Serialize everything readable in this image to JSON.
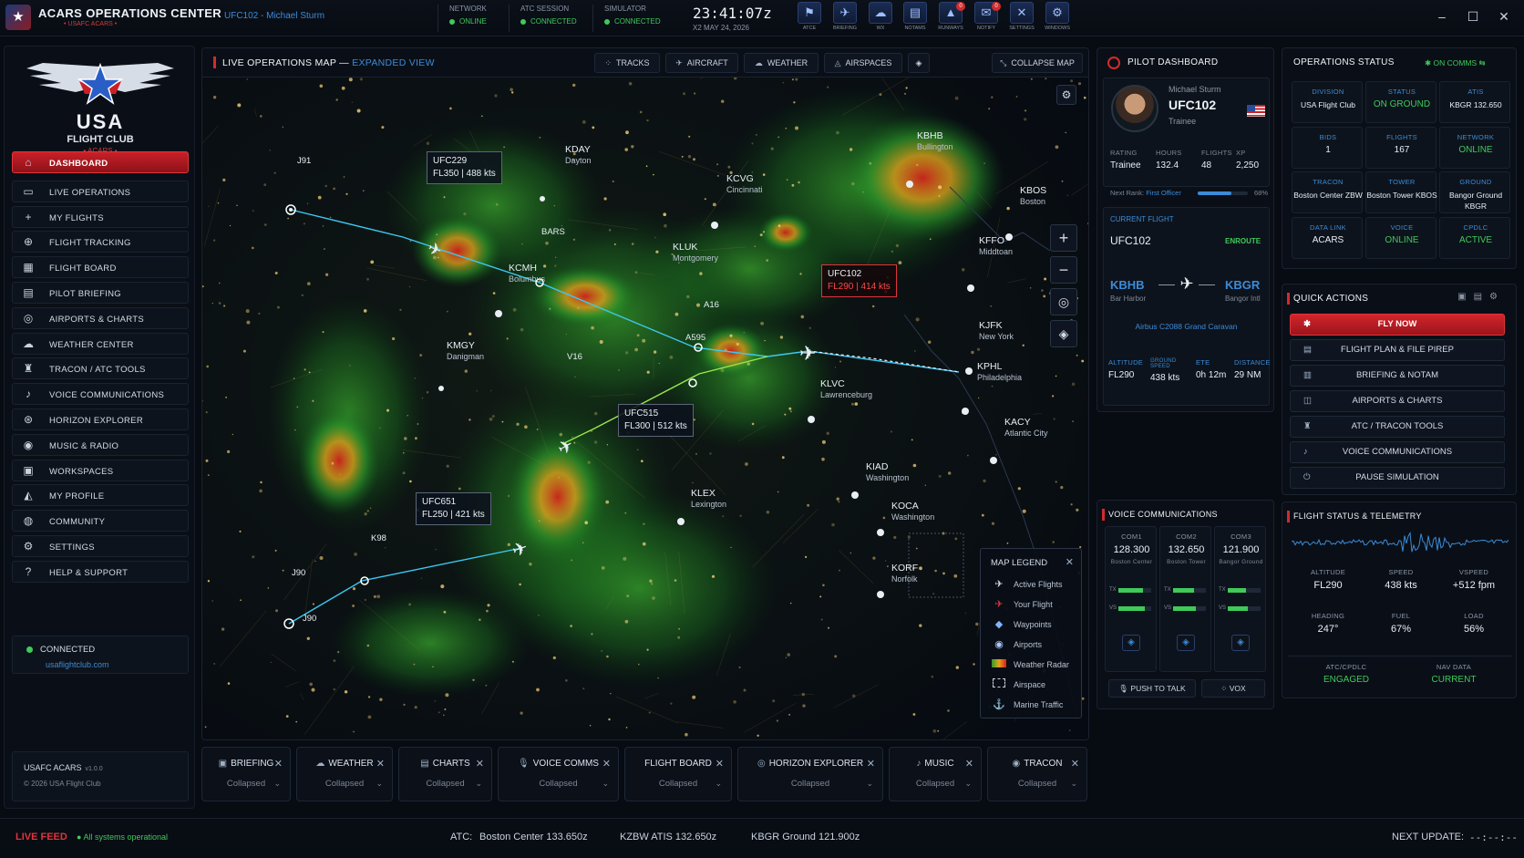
{
  "topbar": {
    "title": "ACARS OPERATIONS CENTER",
    "subtitle": "• USAFC ACARS •",
    "flight_user": "UFC102 - Michael Sturm",
    "network_label": "NETWORK",
    "network_value": "ONLINE",
    "atc_label": "ATC SESSION",
    "atc_value": "CONNECTED",
    "sim_label": "SIMULATOR",
    "sim_value": "CONNECTED",
    "time": "23:41:07z",
    "date": "X2 MAY 24, 2026",
    "buttons": [
      {
        "label": "ATCE",
        "icon": "atc-icon"
      },
      {
        "label": "BRIEFING",
        "icon": "briefing-icon"
      },
      {
        "label": "WX",
        "icon": "weather-icon"
      },
      {
        "label": "NOTAMS",
        "icon": "notams-icon"
      },
      {
        "label": "RUNWAYS",
        "icon": "runways-icon",
        "badge": "0"
      },
      {
        "label": "NOTIFY",
        "icon": "notify-icon",
        "badge": "0"
      },
      {
        "label": "SETTINGS",
        "icon": "settings-icon"
      },
      {
        "label": "WINDOWS",
        "icon": "windows-icon"
      }
    ]
  },
  "sidebar": {
    "brand_title": "USA",
    "brand_sub": "FLIGHT CLUB",
    "brand_tag": "• ACARS •",
    "items": [
      {
        "label": "DASHBOARD",
        "icon": "home-icon",
        "active": true
      },
      {
        "label": "LIVE OPERATIONS",
        "icon": "monitor-icon"
      },
      {
        "label": "MY FLIGHTS",
        "icon": "plane-icon"
      },
      {
        "label": "FLIGHT TRACKING",
        "icon": "target-icon"
      },
      {
        "label": "FLIGHT BOARD",
        "icon": "board-icon"
      },
      {
        "label": "PILOT BRIEFING",
        "icon": "clipboard-icon"
      },
      {
        "label": "AIRPORTS & CHARTS",
        "icon": "airport-icon"
      },
      {
        "label": "WEATHER CENTER",
        "icon": "cloud-icon"
      },
      {
        "label": "TRACON / ATC TOOLS",
        "icon": "tower-icon"
      },
      {
        "label": "VOICE COMMUNICATIONS",
        "icon": "microphone-icon"
      },
      {
        "label": "HORIZON EXPLORER",
        "icon": "compass-icon"
      },
      {
        "label": "MUSIC & RADIO",
        "icon": "music-icon"
      },
      {
        "label": "WORKSPACES",
        "icon": "workspace-icon"
      },
      {
        "label": "MY PROFILE",
        "icon": "profile-icon"
      },
      {
        "label": "COMMUNITY",
        "icon": "community-icon"
      },
      {
        "label": "SETTINGS",
        "icon": "gear-icon"
      },
      {
        "label": "HELP & SUPPORT",
        "icon": "help-icon"
      }
    ],
    "connection_label": "CONNECTED",
    "connection_url": "usaflightclub.com",
    "footer_app": "USAFC ACARS",
    "footer_version": "v1.0.0",
    "footer_copy": "© 2026 USA Flight Club"
  },
  "map": {
    "title": "LIVE OPERATIONS MAP",
    "title_dash": "—",
    "view": "EXPANDED VIEW",
    "buttons": [
      "TRACKS",
      "AIRCRAFT",
      "WEATHER",
      "AIRSPACES"
    ],
    "collapse": "COLLAPSE MAP",
    "flights": [
      {
        "call": "UFC229",
        "data": "FL350 | 488 kts"
      },
      {
        "call": "UFC102",
        "data": "FL290 | 414 kts"
      },
      {
        "call": "UFC515",
        "data": "FL300 | 512 kts"
      },
      {
        "call": "UFC651",
        "data": "FL250 | 421 kts"
      }
    ],
    "waypoints": [
      "J91",
      "BARS",
      "A16",
      "A595",
      "V16",
      "K98",
      "J90",
      "J90"
    ],
    "airports": [
      {
        "code": "KDAY",
        "city": "Dayton"
      },
      {
        "code": "KCVG",
        "city": "Cincinnati"
      },
      {
        "code": "KBHB",
        "city": "Bullington"
      },
      {
        "code": "KBOS",
        "city": "Boston"
      },
      {
        "code": "KCMH",
        "city": "Bolumbus"
      },
      {
        "code": "KLUK",
        "city": "Montgomery"
      },
      {
        "code": "KFFO",
        "city": "Middtoan"
      },
      {
        "code": "KJFK",
        "city": "New York"
      },
      {
        "code": "KMGY",
        "city": "Danigman"
      },
      {
        "code": "KLVC",
        "city": "Lawrenceburg"
      },
      {
        "code": "KPHL",
        "city": "Philadelphia"
      },
      {
        "code": "KACY",
        "city": "Atlantic City"
      },
      {
        "code": "KIAD",
        "city": "Washington"
      },
      {
        "code": "KLEX",
        "city": "Lexington"
      },
      {
        "code": "KOCA",
        "city": "Washington"
      },
      {
        "code": "KORF",
        "city": "Norfolk"
      }
    ],
    "legend_title": "MAP LEGEND",
    "legend": [
      {
        "label": "Active Flights",
        "icon": "plane-white-icon"
      },
      {
        "label": "Your Flight",
        "icon": "plane-red-icon"
      },
      {
        "label": "Waypoints",
        "icon": "waypoint-icon"
      },
      {
        "label": "Airports",
        "icon": "airport-dot-icon"
      },
      {
        "label": "Weather Radar",
        "icon": "radar-swatch-icon"
      },
      {
        "label": "Airspace",
        "icon": "airspace-box-icon"
      },
      {
        "label": "Marine Traffic",
        "icon": "anchor-icon"
      }
    ],
    "zoom_in": "+",
    "zoom_out": "−"
  },
  "dock": [
    {
      "label": "BRIEFING",
      "state": "Collapsed"
    },
    {
      "label": "WEATHER",
      "state": "Collapsed"
    },
    {
      "label": "CHARTS",
      "state": "Collapsed"
    },
    {
      "label": "VOICE COMMS",
      "state": "Collapsed"
    },
    {
      "label": "FLIGHT BOARD",
      "state": "Collapsed"
    },
    {
      "label": "HORIZON EXPLORER",
      "state": "Collapsed"
    },
    {
      "label": "MUSIC",
      "state": "Collapsed"
    },
    {
      "label": "TRACON",
      "state": "Collapsed"
    }
  ],
  "pilot": {
    "header": "PILOT DASHBOARD",
    "name": "Michael Sturm",
    "callsign": "UFC102",
    "rank": "Trainee",
    "stats": [
      {
        "k": "RATING",
        "v": "Trainee"
      },
      {
        "k": "HOURS",
        "v": "132.4"
      },
      {
        "k": "FLIGHTS",
        "v": "48"
      },
      {
        "k": "XP",
        "v": "2,250"
      }
    ],
    "next_rank_label": "Next Rank:",
    "next_rank": "First Officer",
    "next_rank_pct": "68%",
    "progress": 0.68
  },
  "current_flight": {
    "label": "CURRENT FLIGHT",
    "callsign": "UFC102",
    "status": "ENROUTE",
    "from_code": "KBHB",
    "from_name": "Bar Harbor",
    "to_code": "KBGR",
    "to_name": "Bangor Intl",
    "aircraft": "Airbus C2088 Grand Caravan",
    "telemetry": [
      {
        "k": "ALTITUDE",
        "v": "FL290"
      },
      {
        "k": "GROUND SPEED",
        "v": "438 kts"
      },
      {
        "k": "ETE",
        "v": "0h 12m"
      },
      {
        "k": "DISTANCE",
        "v": "29 NM"
      }
    ]
  },
  "ops": {
    "header": "OPERATIONS STATUS",
    "comms": "ON COMMS",
    "cells": [
      {
        "k": "DIVISION",
        "v": "USA Flight Club"
      },
      {
        "k": "STATUS",
        "v": "ON GROUND",
        "green": true
      },
      {
        "k": "ATIS",
        "v": "KBGR 132.650"
      },
      {
        "k": "BIDS",
        "v": "1"
      },
      {
        "k": "FLIGHTS",
        "v": "167"
      },
      {
        "k": "NETWORK",
        "v": "ONLINE",
        "green": true
      },
      {
        "k": "TRACON",
        "v": "Boston Center ZBW"
      },
      {
        "k": "TOWER",
        "v": "Boston Tower KBOS"
      },
      {
        "k": "GROUND",
        "v": "Bangor Ground KBGR"
      },
      {
        "k": "DATA LINK",
        "v": "ACARS"
      },
      {
        "k": "VOICE",
        "v": "ONLINE",
        "green": true
      },
      {
        "k": "CPDLC",
        "v": "ACTIVE",
        "green": true
      }
    ]
  },
  "quick": {
    "header": "QUICK ACTIONS",
    "actions": [
      {
        "label": "FLY NOW",
        "icon": "star-icon"
      },
      {
        "label": "FLIGHT PLAN & FILE PIREP",
        "icon": "flightplan-icon"
      },
      {
        "label": "BRIEFING & NOTAM",
        "icon": "briefing-doc-icon"
      },
      {
        "label": "AIRPORTS & CHARTS",
        "icon": "charts-icon"
      },
      {
        "label": "ATC / TRACON TOOLS",
        "icon": "tracon-icon"
      },
      {
        "label": "VOICE COMMUNICATIONS",
        "icon": "mic-icon"
      },
      {
        "label": "PAUSE SIMULATION",
        "icon": "power-icon"
      }
    ]
  },
  "voice": {
    "header": "VOICE COMMUNICATIONS",
    "coms": [
      {
        "name": "COM1",
        "freq": "128.300",
        "station": "Boston Center",
        "tx": 0.75,
        "rx": 0.8
      },
      {
        "name": "COM2",
        "freq": "132.650",
        "station": "Boston Tower",
        "tx": 0.65,
        "rx": 0.7
      },
      {
        "name": "COM3",
        "freq": "121.900",
        "station": "Bangor Ground",
        "tx": 0.55,
        "rx": 0.6
      }
    ],
    "tx_label": "TX",
    "rx_label": "VS",
    "ptt": "PUSH TO TALK",
    "vox": "VOX"
  },
  "telemetry": {
    "header": "FLIGHT STATUS & TELEMETRY",
    "cells": [
      {
        "k": "ALTITUDE",
        "v": "FL290"
      },
      {
        "k": "SPEED",
        "v": "438 kts"
      },
      {
        "k": "VSPEED",
        "v": "+512 fpm"
      },
      {
        "k": "HEADING",
        "v": "247°"
      },
      {
        "k": "FUEL",
        "v": "67%"
      },
      {
        "k": "LOAD",
        "v": "56%"
      }
    ],
    "atc_label": "ATC/CPDLC",
    "atc_value": "ENGAGED",
    "nav_label": "NAV DATA",
    "nav_value": "CURRENT"
  },
  "bottom": {
    "live": "LIVE FEED",
    "sys": "All systems operational",
    "atc_label": "ATC:",
    "atc1": "Boston Center 133.650z",
    "atc2": "KZBW  ATIS  132.650z",
    "atc3": "KBGR  Ground  121.900z",
    "next": "NEXT UPDATE:",
    "next_val": "--:--:--"
  },
  "colors": {
    "accent": "#3c8bd8",
    "brand_red": "#d32b2b",
    "ok": "#3fca5a"
  }
}
